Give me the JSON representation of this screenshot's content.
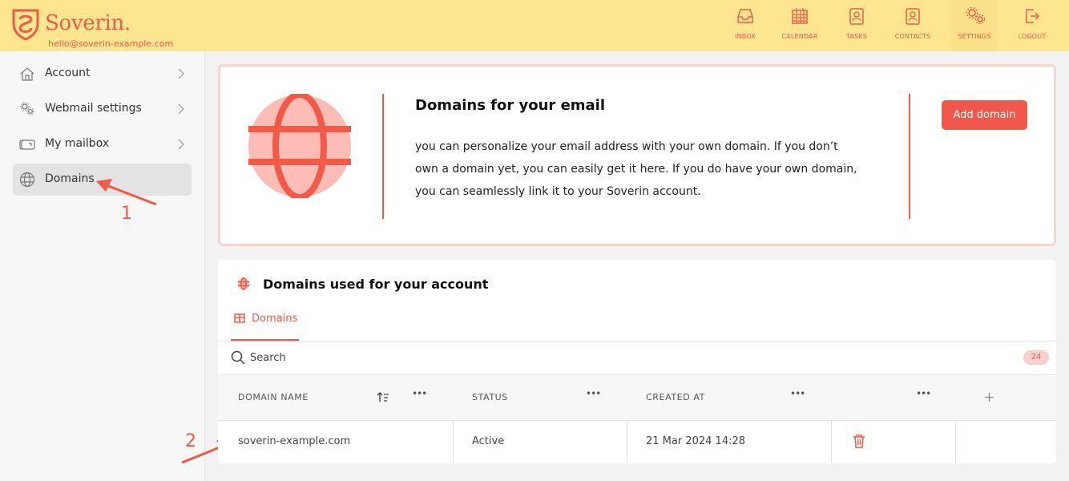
{
  "header": {
    "brand": "Soverin.",
    "email": "hello@soverin-example.com",
    "nav": [
      {
        "label": "INBOX",
        "icon": "inbox-icon"
      },
      {
        "label": "CALENDAR",
        "icon": "calendar-icon"
      },
      {
        "label": "TASKS",
        "icon": "tasks-icon"
      },
      {
        "label": "CONTACTS",
        "icon": "contacts-icon"
      },
      {
        "label": "SETTINGS",
        "icon": "settings-icon"
      },
      {
        "label": "LOGOUT",
        "icon": "logout-icon"
      }
    ],
    "active_nav": "SETTINGS"
  },
  "sidebar": {
    "items": [
      {
        "label": "Account",
        "icon": "home-icon"
      },
      {
        "label": "Webmail settings",
        "icon": "gears-icon"
      },
      {
        "label": "My mailbox",
        "icon": "mailbox-icon"
      },
      {
        "label": "Domains",
        "icon": "globe-icon"
      }
    ],
    "active": "Domains"
  },
  "annotations": {
    "step1": "1",
    "step2": "2"
  },
  "info": {
    "title": "Domains for your email",
    "text": "you can personalize your email address with your own domain. If you don’t own a domain yet, you can easily get it here. If you do have your own domain, you can seamlessly link it to your Soverin account.",
    "button": "Add domain"
  },
  "domains": {
    "title": "Domains used for your account",
    "tab": "Domains",
    "search_placeholder": "Search",
    "count": "24",
    "columns": [
      "DOMAIN NAME",
      "STATUS",
      "CREATED AT"
    ],
    "rows": [
      {
        "domain": "soverin-example.com",
        "status": "Active",
        "created": "21 Mar 2024 14:28"
      }
    ]
  },
  "colors": {
    "accent": "#f15a48",
    "header_bg": "#fde68f",
    "globe_fill": "#fdbcb5"
  }
}
